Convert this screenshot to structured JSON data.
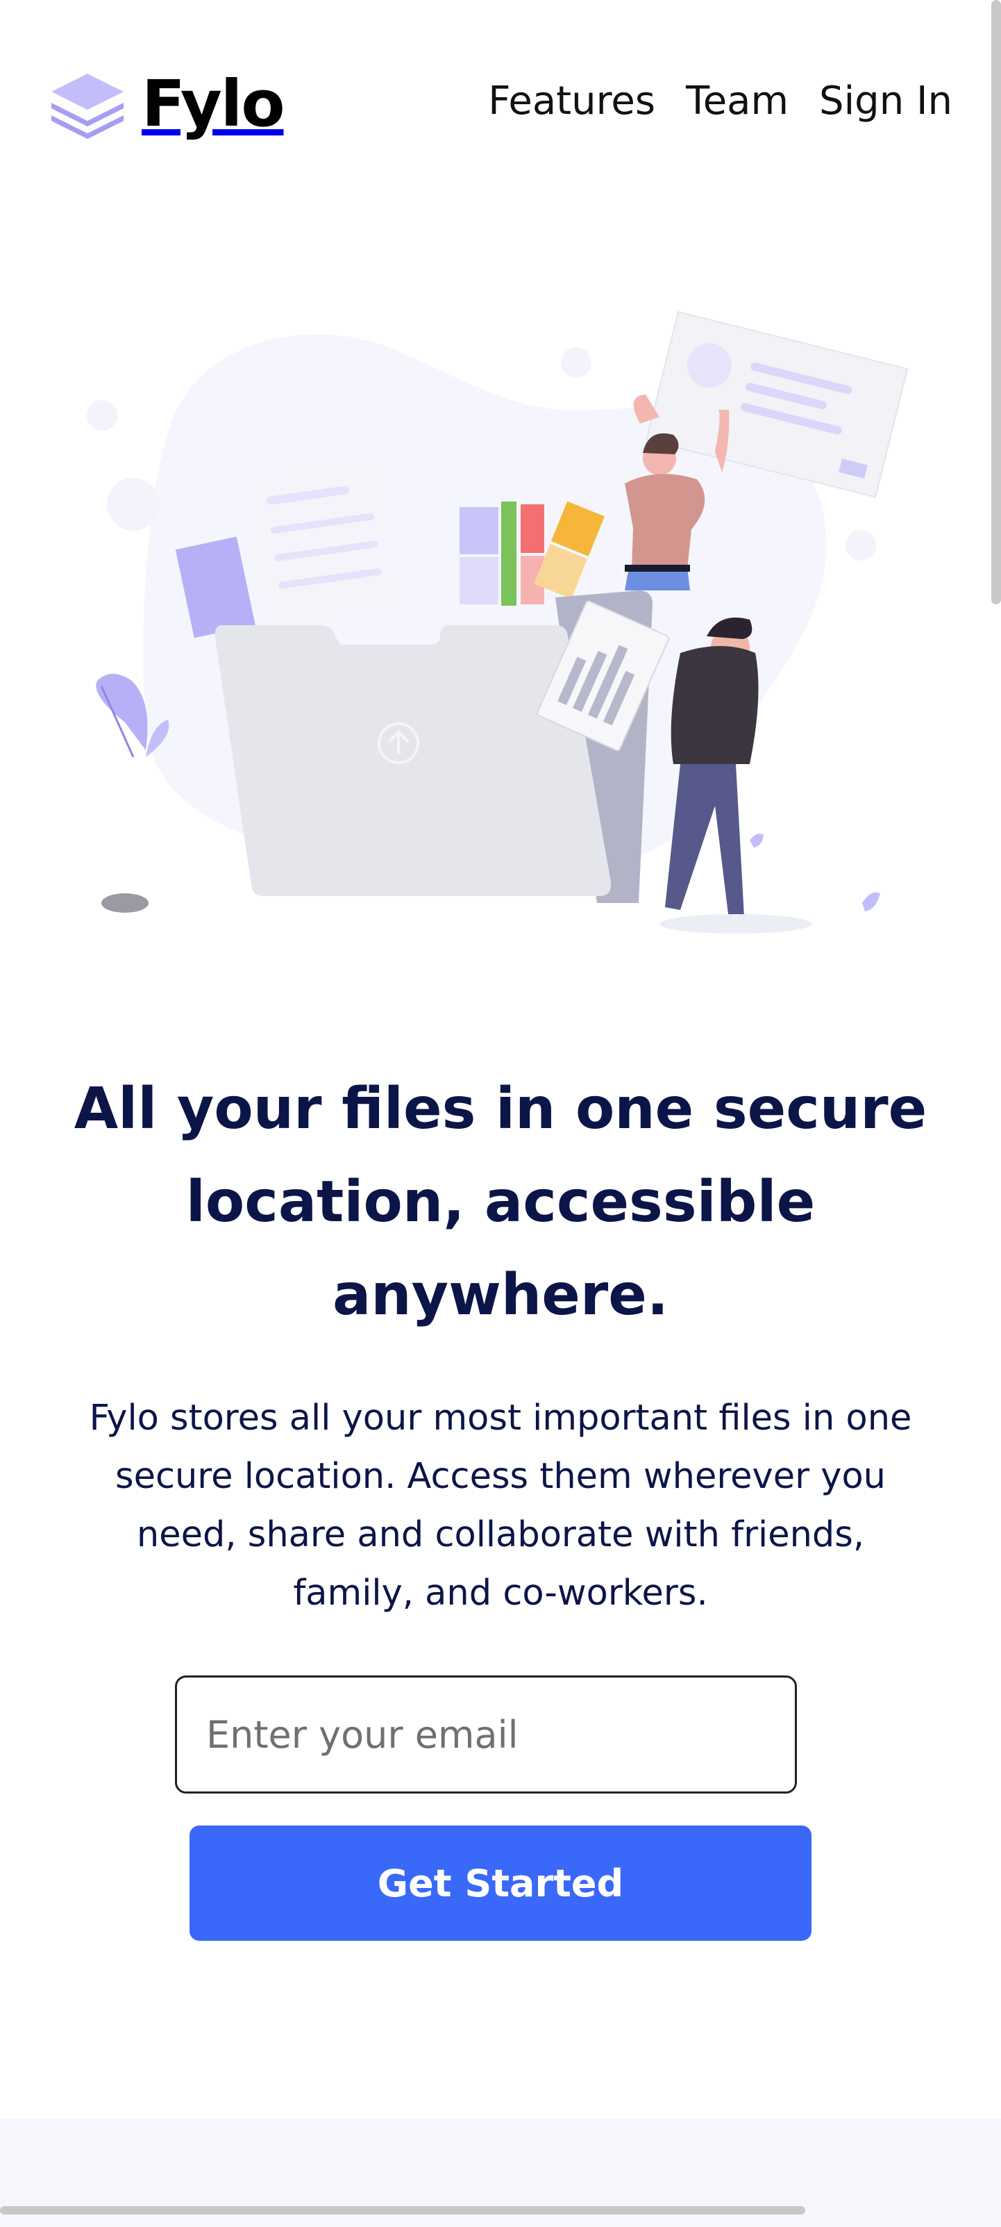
{
  "brand": {
    "name": "Fylo"
  },
  "nav": {
    "items": [
      "Features",
      "Team",
      "Sign In"
    ]
  },
  "hero": {
    "title": "All your files in one secure location, accessible anywhere.",
    "text": "Fylo stores all your most important files in one secure location. Access them wherever you need, share and collaborate with friends, family, and co-workers.",
    "email_placeholder": "Enter your email",
    "cta_label": "Get Started"
  },
  "icons": {
    "logo": "stacked-layers-icon",
    "upload": "upload-arrow-icon"
  },
  "colors": {
    "accent": "#3a68f8",
    "heading": "#0c1548",
    "logo_purple": "#a59ef2",
    "blob": "#f5f6fd",
    "footer_band": "#f6f6fd"
  }
}
